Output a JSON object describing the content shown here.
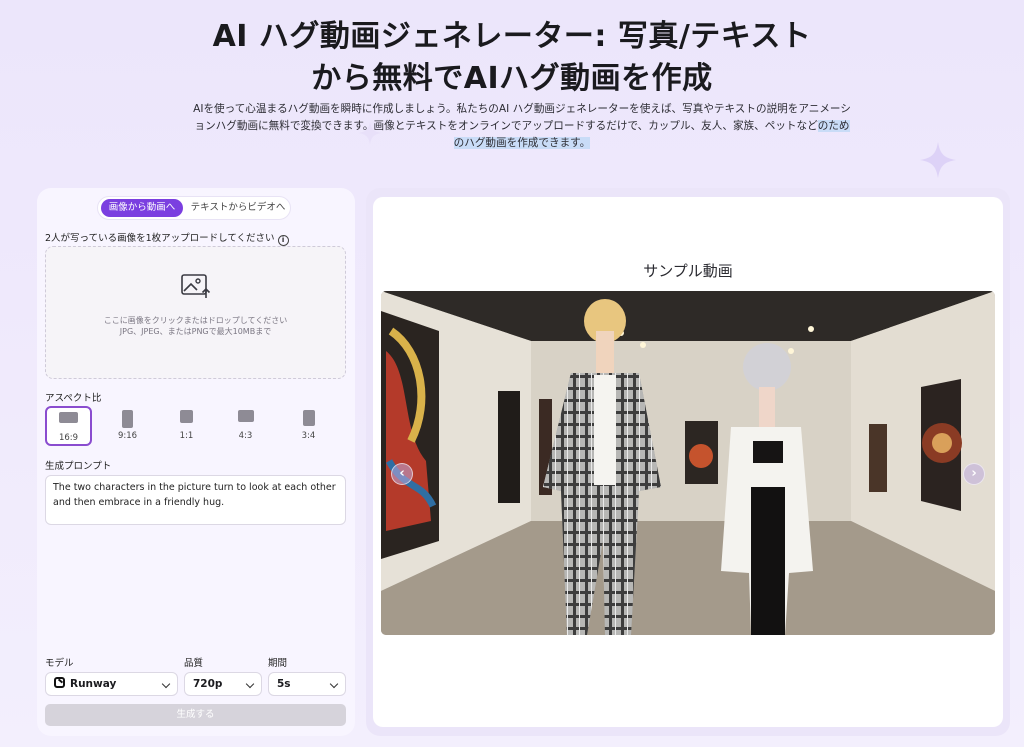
{
  "hero": {
    "title_line1": "AI ハグ動画ジェネレーター: 写真/テキスト",
    "title_line2": "から無料でAIハグ動画を作成",
    "description_main": "AIを使って心温まるハグ動画を瞬時に作成しましょう。私たちのAI ハグ動画ジェネレーターを使えば、写真やテキストの説明をアニメーションハグ動画に無料で変換できます。画像とテキストをオンラインでアップロードするだけで、カップル、友人、家族、ペットなど",
    "description_highlight": "のためのハグ動画を作成できます。"
  },
  "form": {
    "tabs": {
      "image_to_video": "画像から動画へ",
      "text_to_video": "テキストからビデオへ"
    },
    "upload_label": "2人が写っている画像を1枚アップロードしてください",
    "info_icon": "i",
    "dropzone": {
      "line1": "ここに画像をクリックまたはドロップしてください",
      "line2": "JPG、JPEG、またはPNGで最大10MBまで"
    },
    "aspect_label": "アスペクト比",
    "aspect_ratios": [
      {
        "label": "16:9",
        "selected": true
      },
      {
        "label": "9:16",
        "selected": false
      },
      {
        "label": "1:1",
        "selected": false
      },
      {
        "label": "4:3",
        "selected": false
      },
      {
        "label": "3:4",
        "selected": false
      }
    ],
    "prompt_label": "生成プロンプト",
    "prompt_value": "The two characters in the picture turn to look at each other and then embrace in a friendly hug.",
    "model_label": "モデル",
    "model_value": "Runway",
    "quality_label": "品質",
    "quality_value": "720p",
    "duration_label": "期間",
    "duration_value": "5s",
    "generate_label": "生成する"
  },
  "preview": {
    "title": "サンプル動画",
    "prev_icon": "‹",
    "next_icon": "›"
  },
  "colors": {
    "accent": "#7b3fe0",
    "panel_bg": "#f8f5ff",
    "disabled_button": "#d6d3db"
  }
}
